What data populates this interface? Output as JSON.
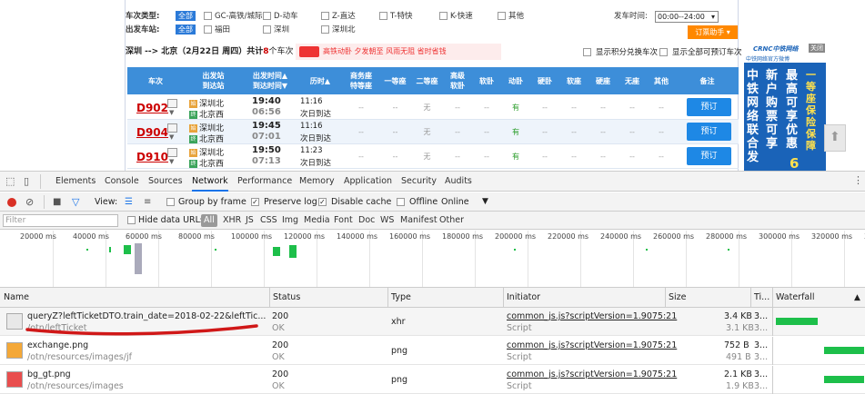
{
  "site": {
    "filter": {
      "train_type_label": "车次类型:",
      "station_label": "出发车站:",
      "all_label": "全部",
      "train_types": [
        "GC-高铁/城际",
        "D-动车",
        "Z-直达",
        "T-特快",
        "K-快速",
        "其他"
      ],
      "stations": [
        "福田",
        "深圳",
        "深圳北"
      ],
      "time_label": "发车时间:",
      "time_value": "00:00--24:00",
      "ticket_helper": "订票助手"
    },
    "route_text": "深圳 --> 北京（2月22日 周四）共计",
    "route_count": "8",
    "route_suffix": "个车次",
    "ad_text": "高铁动卧 夕发朝至 风雨无阻 省时省钱",
    "opt_integral": "显示积分兑换车次",
    "opt_all_bookable": "显示全部可预订车次",
    "headers": [
      "车次",
      "出发站\n到达站",
      "出发时间▲\n到达时间▼",
      "历时▲",
      "商务座\n特等座",
      "一等座",
      "二等座",
      "高级\n软卧",
      "软卧",
      "动卧",
      "硬卧",
      "软座",
      "硬座",
      "无座",
      "其他",
      "备注"
    ],
    "rows": [
      {
        "no": "D902",
        "from": "深圳北",
        "to": "北京西",
        "dep": "19:40",
        "arr": "06:56",
        "dur": "11:16",
        "day": "次日到达",
        "cells": [
          "--",
          "--",
          "无",
          "--",
          "--",
          "有",
          "--",
          "--",
          "--",
          "--",
          "--"
        ],
        "book": "预订"
      },
      {
        "no": "D904",
        "from": "深圳北",
        "to": "北京西",
        "dep": "19:45",
        "arr": "07:01",
        "dur": "11:16",
        "day": "次日到达",
        "cells": [
          "--",
          "--",
          "无",
          "--",
          "--",
          "有",
          "--",
          "--",
          "--",
          "--",
          "--"
        ],
        "book": "预订"
      },
      {
        "no": "D910",
        "from": "深圳北",
        "to": "北京西",
        "dep": "19:50",
        "arr": "07:13",
        "dur": "11:23",
        "day": "次日到达",
        "cells": [
          "--",
          "--",
          "无",
          "--",
          "--",
          "有",
          "--",
          "--",
          "--",
          "--",
          "--"
        ],
        "book": "预订"
      }
    ],
    "side_ad": {
      "brand": "CRNC中铁网络",
      "tagline": "中铁网络官方微博",
      "big1": "中铁网络联合发",
      "big2": "新户购票可享",
      "big3": "最高可享优惠",
      "big4": "一等座保险保障",
      "num": "6",
      "close": "关闭"
    }
  },
  "devtools": {
    "tabs": [
      "Elements",
      "Console",
      "Sources",
      "Network",
      "Performance",
      "Memory",
      "Application",
      "Security",
      "Audits"
    ],
    "active_tab": "Network",
    "toolbar": {
      "view_label": "View:",
      "group_by_frame": "Group by frame",
      "preserve_log": "Preserve log",
      "disable_cache": "Disable cache",
      "offline": "Offline",
      "online": "Online"
    },
    "filter_placeholder": "Filter",
    "hide_data_urls": "Hide data URLs",
    "types": [
      "All",
      "XHR",
      "JS",
      "CSS",
      "Img",
      "Media",
      "Font",
      "Doc",
      "WS",
      "Manifest",
      "Other"
    ],
    "ticks": [
      "20000 ms",
      "40000 ms",
      "60000 ms",
      "80000 ms",
      "100000 ms",
      "120000 ms",
      "140000 ms",
      "160000 ms",
      "180000 ms",
      "200000 ms",
      "220000 ms",
      "240000 ms",
      "260000 ms",
      "280000 ms",
      "300000 ms",
      "320000 ms",
      "340"
    ],
    "columns": [
      "Name",
      "Status",
      "Type",
      "Initiator",
      "Size",
      "Ti...",
      "Waterfall"
    ],
    "requests": [
      {
        "name": "queryZ?leftTicketDTO.train_date=2018-02-22&leftTic...&leftTi...",
        "path": "/otn/leftTicket",
        "status": "200",
        "status_text": "OK",
        "type": "xhr",
        "initiator": "common_js.js?scriptVersion=1.9075:21",
        "initiator_sub": "Script",
        "size": "3.4 KB",
        "size_sub": "3.1 KB",
        "time": "3...",
        "time_sub": "3..."
      },
      {
        "name": "exchange.png",
        "path": "/otn/resources/images/jf",
        "status": "200",
        "status_text": "OK",
        "type": "png",
        "initiator": "common_js.js?scriptVersion=1.9075:21",
        "initiator_sub": "Script",
        "size": "752 B",
        "size_sub": "491 B",
        "time": "3...",
        "time_sub": "3..."
      },
      {
        "name": "bg_gt.png",
        "path": "/otn/resources/images",
        "status": "200",
        "status_text": "OK",
        "type": "png",
        "initiator": "common_js.js?scriptVersion=1.9075:21",
        "initiator_sub": "Script",
        "size": "2.1 KB",
        "size_sub": "1.9 KB",
        "time": "3...",
        "time_sub": "3..."
      }
    ]
  },
  "colors": {
    "accent": "#1a73e8",
    "header_blue": "#3d8ed9",
    "train_red": "#cc0000",
    "waterfall_green": "#1dbf4a",
    "annotation_red": "#d01818"
  }
}
